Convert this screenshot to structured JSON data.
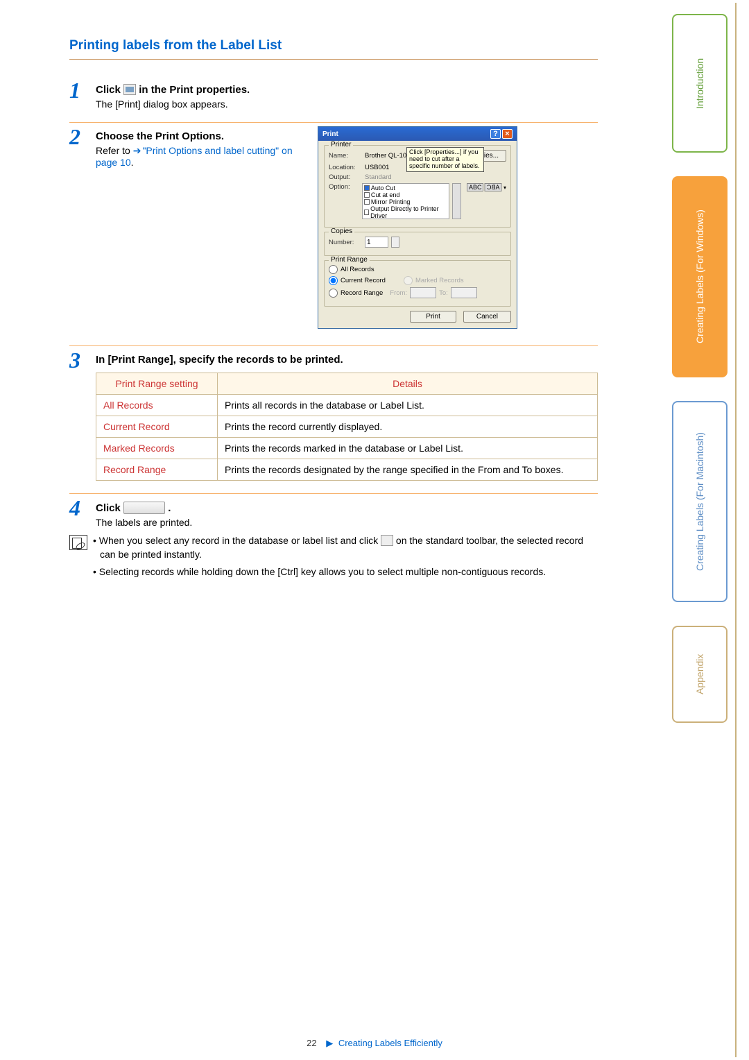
{
  "section_title": "Printing labels from the Label List",
  "steps": {
    "one": {
      "num": "1",
      "headline_pre": "Click ",
      "headline_post": " in the Print properties.",
      "sub": "The [Print] dialog box appears."
    },
    "two": {
      "num": "2",
      "headline": "Choose the Print Options.",
      "refer_pre": "Refer to ",
      "refer_link": "\"Print Options and label cutting\" on page 10",
      "refer_post": "."
    },
    "three": {
      "num": "3",
      "headline": "In [Print Range], specify the records to be printed."
    },
    "four": {
      "num": "4",
      "headline_pre": "Click ",
      "headline_post": ".",
      "sub": "The labels are printed."
    }
  },
  "dialog": {
    "title": "Print",
    "printer_group": "Printer",
    "name_lbl": "Name:",
    "name_val": "Brother QL-1050",
    "location_lbl": "Location:",
    "location_val": "USB001",
    "output_lbl": "Output:",
    "output_val": "Standard",
    "option_lbl": "Option:",
    "opts": [
      "Auto Cut",
      "Cut at end",
      "Mirror Printing",
      "Output Directly to Printer Driver"
    ],
    "tooltip": "Click [Properties...] if you need to cut after a specific number of labels.",
    "properties_btn": "Properties...",
    "abc": "ABC",
    "copies_group": "Copies",
    "number_lbl": "Number:",
    "number_val": "1",
    "range_group": "Print Range",
    "all_records": "All Records",
    "current_record": "Current Record",
    "marked_records": "Marked Records",
    "record_range": "Record Range",
    "from_lbl": "From:",
    "to_lbl": "To:",
    "print_btn": "Print",
    "cancel_btn": "Cancel"
  },
  "table": {
    "h1": "Print Range setting",
    "h2": "Details",
    "rows": [
      {
        "name": "All Records",
        "detail": "Prints all records in the database or Label List."
      },
      {
        "name": "Current Record",
        "detail": "Prints the record currently displayed."
      },
      {
        "name": "Marked Records",
        "detail": "Prints the records marked in the database or Label List."
      },
      {
        "name": "Record Range",
        "detail": "Prints the records designated by the range specified in the From and To boxes."
      }
    ]
  },
  "notes": {
    "n1_pre": "When you select any record in the database or label list and click ",
    "n1_post": " on the standard toolbar, the selected record can be printed instantly.",
    "n2": "Selecting records while holding down the [Ctrl] key allows you to select multiple non-contiguous records."
  },
  "side": {
    "intro": "Introduction",
    "win": "Creating Labels (For Windows)",
    "mac": "Creating Labels (For Macintosh)",
    "appx": "Appendix"
  },
  "footer": {
    "page": "22",
    "crumb": "Creating Labels Efficiently"
  }
}
